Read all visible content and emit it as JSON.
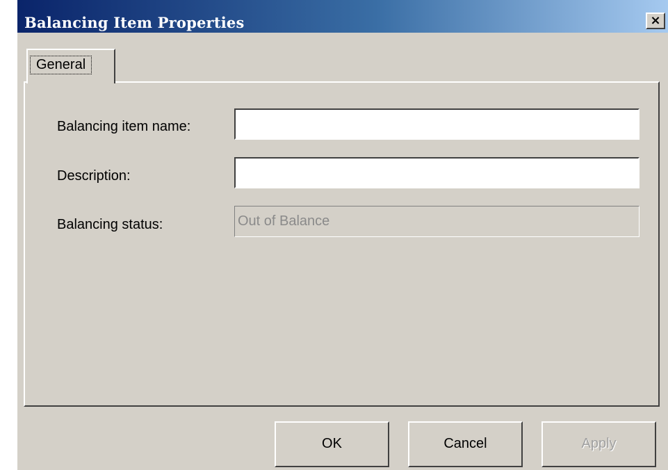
{
  "window": {
    "title": "Balancing Item Properties",
    "close_icon": "×",
    "colors": {
      "face": "#d4d0c8",
      "title_gradient_start": "#0a246a",
      "title_gradient_end": "#a6caf0"
    }
  },
  "tabs": [
    {
      "label": "General",
      "selected": true
    }
  ],
  "form": {
    "name_label": "Balancing item name:",
    "name_value": "",
    "description_label": "Description:",
    "description_value": "",
    "status_label": "Balancing status:",
    "status_value": "Out of Balance"
  },
  "buttons": {
    "ok": "OK",
    "cancel": "Cancel",
    "apply": "Apply",
    "apply_enabled": false
  }
}
